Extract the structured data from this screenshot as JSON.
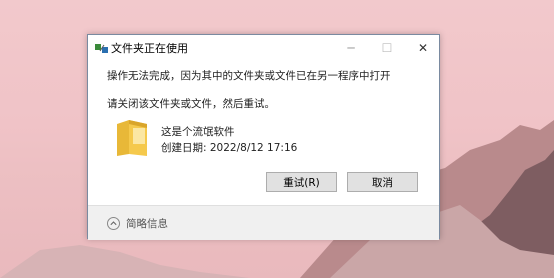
{
  "dialog": {
    "title": "文件夹正在使用",
    "message": "操作无法完成，因为其中的文件夹或文件已在另一程序中打开",
    "instruction": "请关闭该文件夹或文件，然后重试。",
    "file": {
      "name": "这是个流氓软件",
      "created": "创建日期: 2022/8/12 17:16"
    },
    "buttons": {
      "retry": "重试(R)",
      "cancel": "取消"
    },
    "details_label": "简略信息",
    "window_controls": {
      "minimize": "─",
      "maximize": "☐",
      "close": "✕"
    }
  },
  "icons": {
    "app": "file-move-icon",
    "folder": "folder-icon",
    "details": "chevron-up-icon"
  },
  "colors": {
    "background": "#f0c3c7",
    "dialog": "#ffffff",
    "button": "#e1e1e1",
    "folder": "#f5c94c"
  }
}
